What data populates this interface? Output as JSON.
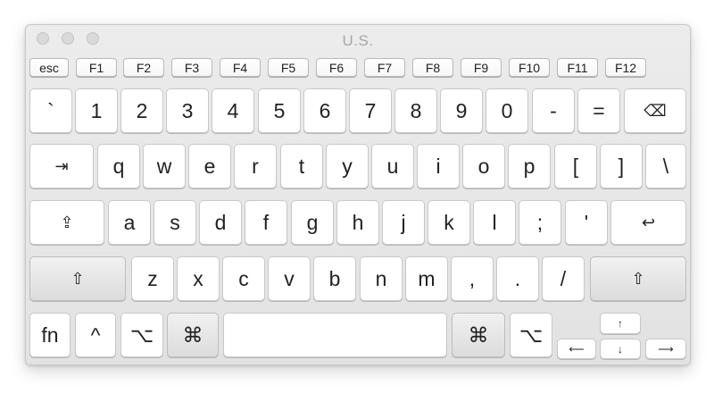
{
  "window": {
    "title": "U.S."
  },
  "keyboard": {
    "function_row": [
      "esc",
      "F1",
      "F2",
      "F3",
      "F4",
      "F5",
      "F6",
      "F7",
      "F8",
      "F9",
      "F10",
      "F11",
      "F12"
    ],
    "number_row": [
      "`",
      "1",
      "2",
      "3",
      "4",
      "5",
      "6",
      "7",
      "8",
      "9",
      "0",
      "-",
      "=",
      "⌫"
    ],
    "qwerty_row": [
      "⇥",
      "q",
      "w",
      "e",
      "r",
      "t",
      "y",
      "u",
      "i",
      "o",
      "p",
      "[",
      "]",
      "\\"
    ],
    "home_row": [
      "⇪",
      "a",
      "s",
      "d",
      "f",
      "g",
      "h",
      "j",
      "k",
      "l",
      ";",
      "'",
      "↩"
    ],
    "shift_row": [
      "⇧",
      "z",
      "x",
      "c",
      "v",
      "b",
      "n",
      "m",
      ",",
      ".",
      "/",
      "⇧"
    ],
    "bottom_row": {
      "fn": "fn",
      "control": "^",
      "option_left": "⌥",
      "command_left": "⌘",
      "space": "",
      "command_right": "⌘",
      "option_right": "⌥",
      "arrow_up": "↑",
      "arrow_left": "⟵",
      "arrow_down": "↓",
      "arrow_right": "⟶"
    }
  }
}
